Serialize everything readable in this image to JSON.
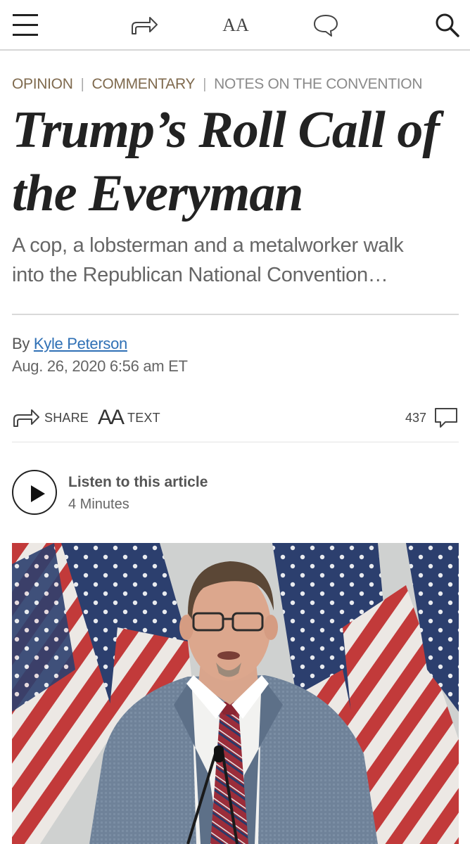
{
  "topbar": {
    "icons": [
      "menu-icon",
      "share-icon",
      "text-size-icon",
      "comment-icon",
      "search-icon"
    ],
    "text_size_label": "AA"
  },
  "breadcrumb": [
    "OPINION",
    "COMMENTARY",
    "NOTES ON THE CONVENTION"
  ],
  "breadcrumb_separator": "|",
  "headline": {
    "line1": "Trump’s Roll Call of",
    "line2": "the Everyman"
  },
  "dek": {
    "line1": "A cop, a lobsterman and a metalworker walk",
    "line2": "into the Republican National Convention…"
  },
  "byline": {
    "prefix": "By",
    "author": "Kyle Peterson",
    "date": "Aug. 26, 2020 6:56 am ET"
  },
  "toolbar": {
    "share_label": "SHARE",
    "text_label": "TEXT",
    "text_icon_glyph": "AA",
    "comment_count": "437"
  },
  "audio": {
    "title": "Listen to this article",
    "duration": "4 Minutes"
  },
  "colors": {
    "section_kicker": "#7f6a4e",
    "link": "#2f70b5",
    "headline": "#222222"
  }
}
